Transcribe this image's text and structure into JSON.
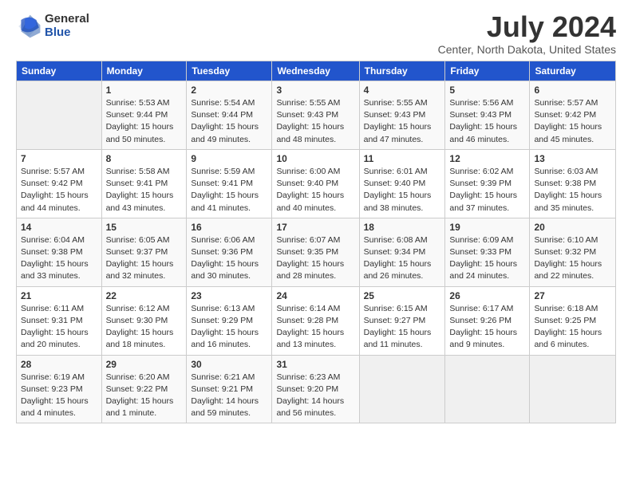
{
  "logo": {
    "general": "General",
    "blue": "Blue"
  },
  "title": "July 2024",
  "subtitle": "Center, North Dakota, United States",
  "headers": [
    "Sunday",
    "Monday",
    "Tuesday",
    "Wednesday",
    "Thursday",
    "Friday",
    "Saturday"
  ],
  "weeks": [
    [
      {
        "day": "",
        "info": ""
      },
      {
        "day": "1",
        "info": "Sunrise: 5:53 AM\nSunset: 9:44 PM\nDaylight: 15 hours\nand 50 minutes."
      },
      {
        "day": "2",
        "info": "Sunrise: 5:54 AM\nSunset: 9:44 PM\nDaylight: 15 hours\nand 49 minutes."
      },
      {
        "day": "3",
        "info": "Sunrise: 5:55 AM\nSunset: 9:43 PM\nDaylight: 15 hours\nand 48 minutes."
      },
      {
        "day": "4",
        "info": "Sunrise: 5:55 AM\nSunset: 9:43 PM\nDaylight: 15 hours\nand 47 minutes."
      },
      {
        "day": "5",
        "info": "Sunrise: 5:56 AM\nSunset: 9:43 PM\nDaylight: 15 hours\nand 46 minutes."
      },
      {
        "day": "6",
        "info": "Sunrise: 5:57 AM\nSunset: 9:42 PM\nDaylight: 15 hours\nand 45 minutes."
      }
    ],
    [
      {
        "day": "7",
        "info": "Sunrise: 5:57 AM\nSunset: 9:42 PM\nDaylight: 15 hours\nand 44 minutes."
      },
      {
        "day": "8",
        "info": "Sunrise: 5:58 AM\nSunset: 9:41 PM\nDaylight: 15 hours\nand 43 minutes."
      },
      {
        "day": "9",
        "info": "Sunrise: 5:59 AM\nSunset: 9:41 PM\nDaylight: 15 hours\nand 41 minutes."
      },
      {
        "day": "10",
        "info": "Sunrise: 6:00 AM\nSunset: 9:40 PM\nDaylight: 15 hours\nand 40 minutes."
      },
      {
        "day": "11",
        "info": "Sunrise: 6:01 AM\nSunset: 9:40 PM\nDaylight: 15 hours\nand 38 minutes."
      },
      {
        "day": "12",
        "info": "Sunrise: 6:02 AM\nSunset: 9:39 PM\nDaylight: 15 hours\nand 37 minutes."
      },
      {
        "day": "13",
        "info": "Sunrise: 6:03 AM\nSunset: 9:38 PM\nDaylight: 15 hours\nand 35 minutes."
      }
    ],
    [
      {
        "day": "14",
        "info": "Sunrise: 6:04 AM\nSunset: 9:38 PM\nDaylight: 15 hours\nand 33 minutes."
      },
      {
        "day": "15",
        "info": "Sunrise: 6:05 AM\nSunset: 9:37 PM\nDaylight: 15 hours\nand 32 minutes."
      },
      {
        "day": "16",
        "info": "Sunrise: 6:06 AM\nSunset: 9:36 PM\nDaylight: 15 hours\nand 30 minutes."
      },
      {
        "day": "17",
        "info": "Sunrise: 6:07 AM\nSunset: 9:35 PM\nDaylight: 15 hours\nand 28 minutes."
      },
      {
        "day": "18",
        "info": "Sunrise: 6:08 AM\nSunset: 9:34 PM\nDaylight: 15 hours\nand 26 minutes."
      },
      {
        "day": "19",
        "info": "Sunrise: 6:09 AM\nSunset: 9:33 PM\nDaylight: 15 hours\nand 24 minutes."
      },
      {
        "day": "20",
        "info": "Sunrise: 6:10 AM\nSunset: 9:32 PM\nDaylight: 15 hours\nand 22 minutes."
      }
    ],
    [
      {
        "day": "21",
        "info": "Sunrise: 6:11 AM\nSunset: 9:31 PM\nDaylight: 15 hours\nand 20 minutes."
      },
      {
        "day": "22",
        "info": "Sunrise: 6:12 AM\nSunset: 9:30 PM\nDaylight: 15 hours\nand 18 minutes."
      },
      {
        "day": "23",
        "info": "Sunrise: 6:13 AM\nSunset: 9:29 PM\nDaylight: 15 hours\nand 16 minutes."
      },
      {
        "day": "24",
        "info": "Sunrise: 6:14 AM\nSunset: 9:28 PM\nDaylight: 15 hours\nand 13 minutes."
      },
      {
        "day": "25",
        "info": "Sunrise: 6:15 AM\nSunset: 9:27 PM\nDaylight: 15 hours\nand 11 minutes."
      },
      {
        "day": "26",
        "info": "Sunrise: 6:17 AM\nSunset: 9:26 PM\nDaylight: 15 hours\nand 9 minutes."
      },
      {
        "day": "27",
        "info": "Sunrise: 6:18 AM\nSunset: 9:25 PM\nDaylight: 15 hours\nand 6 minutes."
      }
    ],
    [
      {
        "day": "28",
        "info": "Sunrise: 6:19 AM\nSunset: 9:23 PM\nDaylight: 15 hours\nand 4 minutes."
      },
      {
        "day": "29",
        "info": "Sunrise: 6:20 AM\nSunset: 9:22 PM\nDaylight: 15 hours\nand 1 minute."
      },
      {
        "day": "30",
        "info": "Sunrise: 6:21 AM\nSunset: 9:21 PM\nDaylight: 14 hours\nand 59 minutes."
      },
      {
        "day": "31",
        "info": "Sunrise: 6:23 AM\nSunset: 9:20 PM\nDaylight: 14 hours\nand 56 minutes."
      },
      {
        "day": "",
        "info": ""
      },
      {
        "day": "",
        "info": ""
      },
      {
        "day": "",
        "info": ""
      }
    ]
  ]
}
